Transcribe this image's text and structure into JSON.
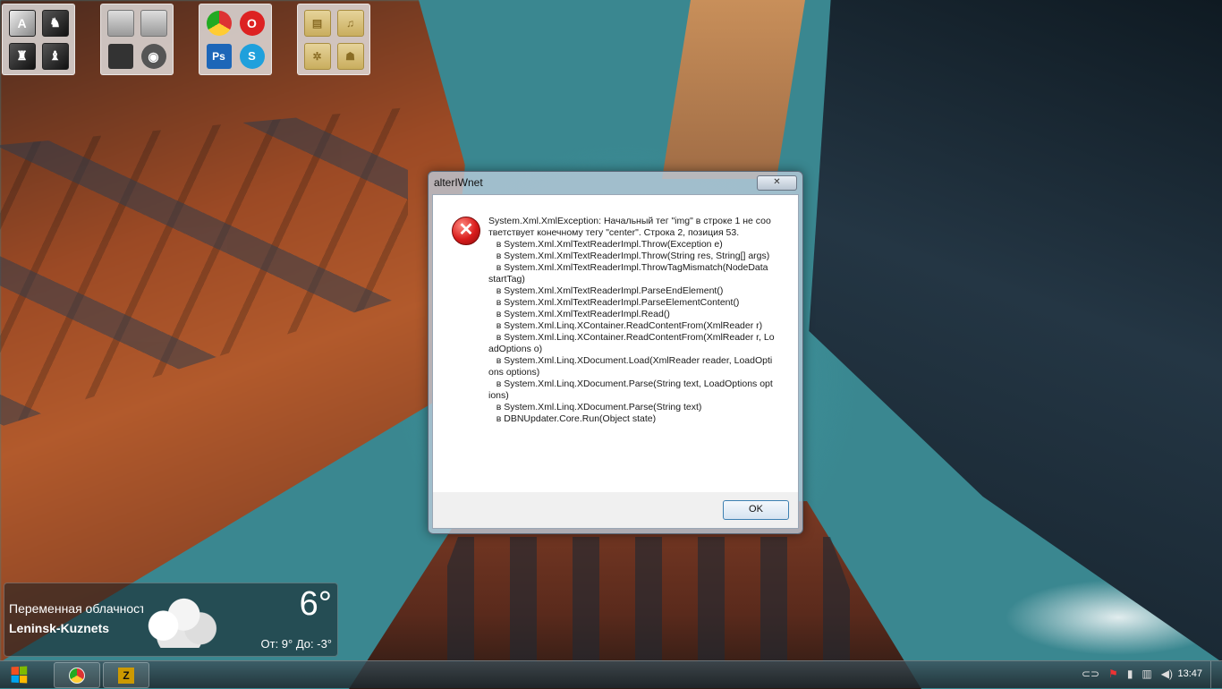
{
  "desktop": {
    "fences": [
      {
        "name": "games",
        "icons": [
          {
            "name": "assassins-creed-icon",
            "glyph": "A"
          },
          {
            "name": "game-icon-2",
            "glyph": "♞"
          },
          {
            "name": "game-icon-3",
            "glyph": "♜"
          },
          {
            "name": "game-icon-4",
            "glyph": "♝"
          }
        ]
      },
      {
        "name": "system",
        "icons": [
          {
            "name": "drive-icon-1",
            "glyph": ""
          },
          {
            "name": "drive-icon-2",
            "glyph": ""
          },
          {
            "name": "floppy-icon",
            "glyph": ""
          },
          {
            "name": "disc-drive-icon",
            "glyph": "◉"
          }
        ]
      },
      {
        "name": "apps",
        "icons": [
          {
            "name": "chrome-icon",
            "glyph": ""
          },
          {
            "name": "opera-icon",
            "glyph": "O"
          },
          {
            "name": "photoshop-icon",
            "glyph": "Ps"
          },
          {
            "name": "skype-icon",
            "glyph": "S"
          }
        ]
      },
      {
        "name": "folders",
        "icons": [
          {
            "name": "documents-folder-icon",
            "glyph": "▤"
          },
          {
            "name": "music-folder-icon",
            "glyph": "♫"
          },
          {
            "name": "settings-folder-icon",
            "glyph": "✲"
          },
          {
            "name": "user-folder-icon",
            "glyph": "☗"
          }
        ]
      }
    ]
  },
  "dialog": {
    "title": "alterIWnet",
    "close_label": "✕",
    "message": "System.Xml.XmlException: Начальный тег \"img\" в строке 1 не соответствует конечному тегу \"center\". Строка 2, позиция 53.\n   в System.Xml.XmlTextReaderImpl.Throw(Exception e)\n   в System.Xml.XmlTextReaderImpl.Throw(String res, String[] args)\n   в System.Xml.XmlTextReaderImpl.ThrowTagMismatch(NodeData startTag)\n   в System.Xml.XmlTextReaderImpl.ParseEndElement()\n   в System.Xml.XmlTextReaderImpl.ParseElementContent()\n   в System.Xml.XmlTextReaderImpl.Read()\n   в System.Xml.Linq.XContainer.ReadContentFrom(XmlReader r)\n   в System.Xml.Linq.XContainer.ReadContentFrom(XmlReader r, LoadOptions o)\n   в System.Xml.Linq.XDocument.Load(XmlReader reader, LoadOptions options)\n   в System.Xml.Linq.XDocument.Parse(String text, LoadOptions options)\n   в System.Xml.Linq.XDocument.Parse(String text)\n   в DBNUpdater.Core.Run(Object state)",
    "ok_label": "OK"
  },
  "weather": {
    "condition": "Переменная облачность",
    "city": "Leninsk-Kuznets",
    "temperature": "6°",
    "range": "От: 9° До: -3°"
  },
  "taskbar": {
    "apps": [
      "chrome",
      "game"
    ],
    "game_glyph": "Z",
    "clock": "13:47",
    "tray_icons": [
      "toggle-icon",
      "action-center-flag-icon",
      "power-icon",
      "network-icon",
      "volume-icon"
    ]
  }
}
